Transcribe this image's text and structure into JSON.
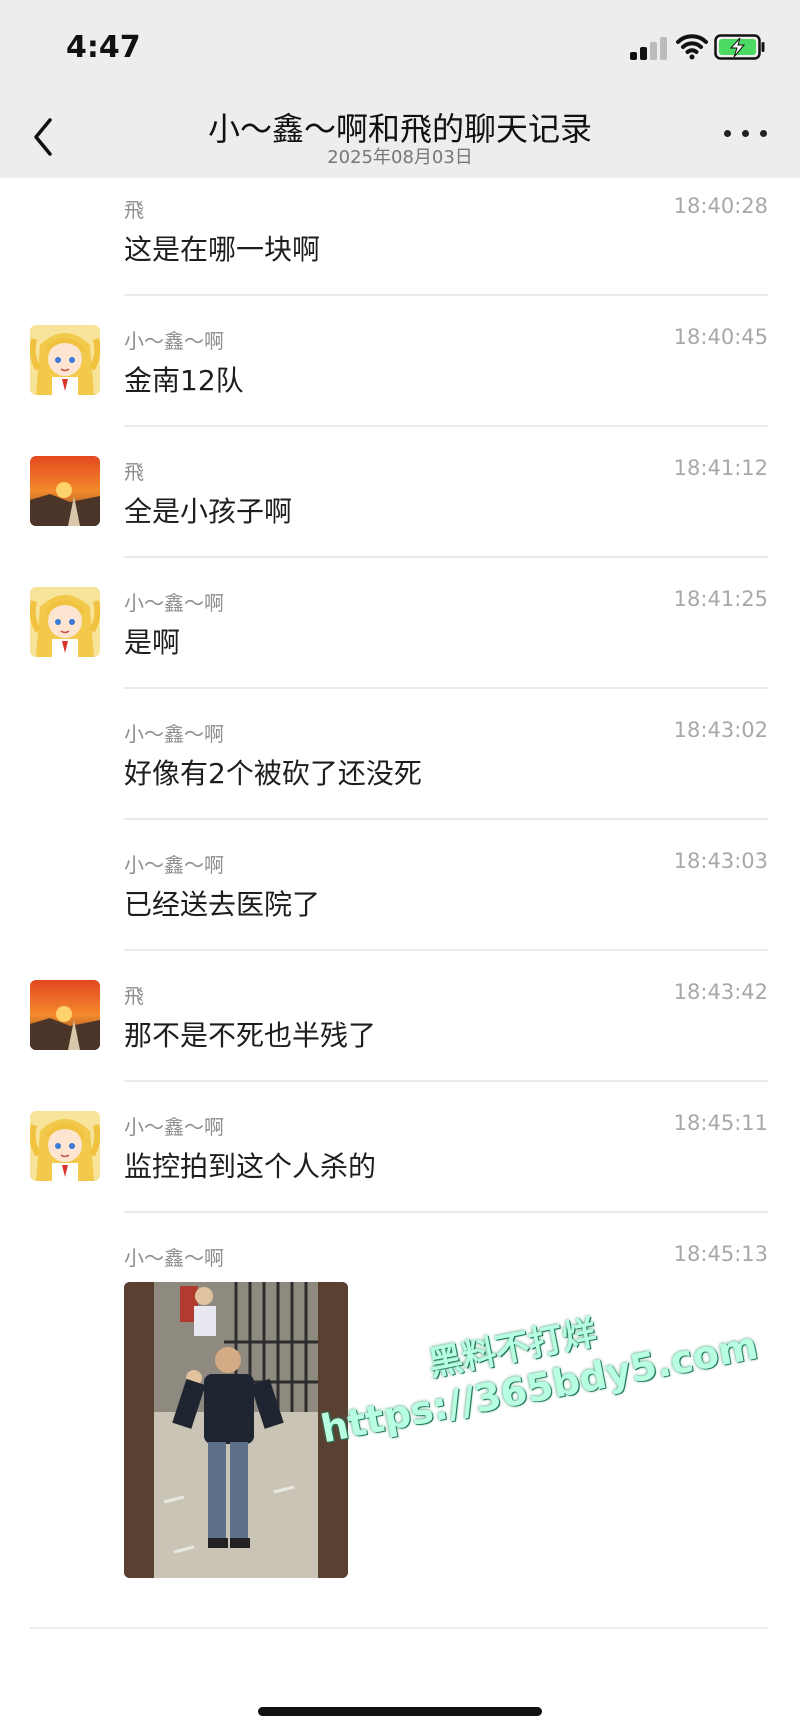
{
  "status_bar": {
    "time": "4:47"
  },
  "header": {
    "title": "小～鑫～啊和飛的聊天记录",
    "date": "2025年08月03日"
  },
  "icons": {
    "back": "chevron-left-icon",
    "more": "more-dots-icon",
    "signal": "cellular-signal-icon",
    "wifi": "wifi-icon",
    "battery": "battery-charging-icon"
  },
  "colors": {
    "header_bg": "#ededed",
    "battery_fill": "#4cd964"
  },
  "messages": [
    {
      "sender": "飛",
      "time": "18:40:28",
      "text": "这是在哪一块啊"
    },
    {
      "sender": "小～鑫～啊",
      "time": "18:40:45",
      "text": "金南12队"
    },
    {
      "sender": "飛",
      "time": "18:41:12",
      "text": "全是小孩子啊"
    },
    {
      "sender": "小～鑫～啊",
      "time": "18:41:25",
      "text": "是啊"
    },
    {
      "sender": "小～鑫～啊",
      "time": "18:43:02",
      "text": "好像有2个被砍了还没死"
    },
    {
      "sender": "小～鑫～啊",
      "time": "18:43:03",
      "text": "已经送去医院了"
    },
    {
      "sender": "飛",
      "time": "18:43:42",
      "text": "那不是不死也半残了"
    },
    {
      "sender": "小～鑫～啊",
      "time": "18:45:11",
      "text": "监控拍到这个人杀的"
    },
    {
      "sender": "小～鑫～啊",
      "time": "18:45:13",
      "image": "photo-surveillance"
    }
  ],
  "watermark": {
    "line1": "黑料不打烊",
    "line2": "https://365bdy5.com"
  }
}
